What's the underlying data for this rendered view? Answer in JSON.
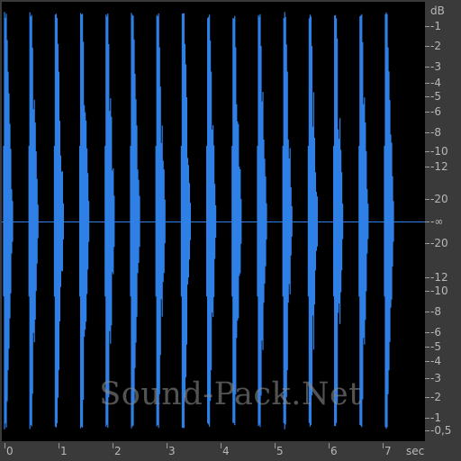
{
  "watermark": "Sound-Pack.Net",
  "colors": {
    "waveform": "#2e7fe6",
    "background": "#000000",
    "axis_text": "#b8b8b8",
    "frame": "#3a3a3a"
  },
  "db_axis": {
    "unit": "dB",
    "ticks": [
      "-1",
      "-2",
      "-3",
      "-4",
      "-5",
      "-6",
      "-8",
      "-10",
      "-12",
      "-20",
      "-∞",
      "-20",
      "-12",
      "-10",
      "-8",
      "-6",
      "-5",
      "-4",
      "-3",
      "-2",
      "-1",
      "-0,5"
    ]
  },
  "time_axis": {
    "unit": "sec",
    "ticks": [
      "0",
      "1",
      "2",
      "3",
      "4",
      "5",
      "6",
      "7"
    ]
  },
  "waveform": {
    "burst_count": 16,
    "duration_sec": 7.4,
    "burst_period_sec": 0.47
  }
}
